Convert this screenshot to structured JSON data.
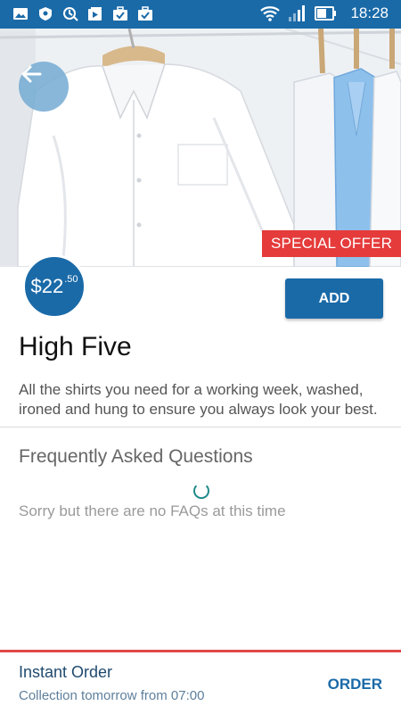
{
  "status_bar": {
    "time": "18:28",
    "icons_left": [
      "gallery-icon",
      "shield-icon",
      "sync-icon",
      "media-icon",
      "briefcase-check-icon",
      "briefcase-check-icon"
    ],
    "icons_right": [
      "wifi-icon",
      "signal-icon",
      "battery-icon"
    ]
  },
  "hero": {
    "special_offer": "SPECIAL OFFER",
    "back_icon": "arrow-left-icon"
  },
  "product": {
    "price_main": "$22",
    "price_cents": ".50",
    "add_label": "ADD",
    "title": "High Five",
    "description": "All the shirts you need for a working week, washed, ironed and hung to ensure you always look your best."
  },
  "faq": {
    "title": "Frequently Asked Questions",
    "empty_message": "Sorry but there are no FAQs at this time"
  },
  "bottom_bar": {
    "title": "Instant Order",
    "subtitle": "Collection tomorrow from 07:00",
    "order_label": "ORDER"
  },
  "colors": {
    "primary": "#1a6aa8",
    "offer_red": "#e53b3b",
    "spinner": "#1d8a8a"
  }
}
